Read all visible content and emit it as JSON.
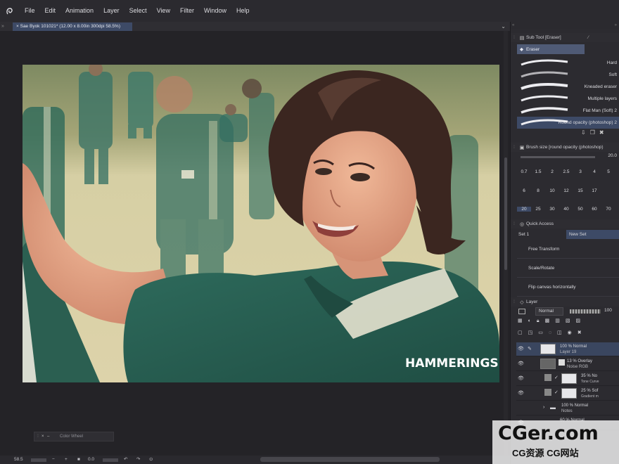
{
  "menu": {
    "items": [
      "File",
      "Edit",
      "Animation",
      "Layer",
      "Select",
      "View",
      "Filter",
      "Window",
      "Help"
    ]
  },
  "document_tab": {
    "title": "Sae Byok 101021* (12.00 x 8.00in 300dpi 58.5%)"
  },
  "artwork": {
    "signature": "HAMMERINGS"
  },
  "sub_tool": {
    "header": "Sub Tool [Eraser]",
    "group": "Eraser",
    "brushes": [
      {
        "label": "Hard",
        "selected": false
      },
      {
        "label": "Soft",
        "selected": false
      },
      {
        "label": "Kneaded eraser",
        "selected": false
      },
      {
        "label": "Multiple layers",
        "selected": false
      },
      {
        "label": "Flat Man (Soft) 2",
        "selected": false
      },
      {
        "label": "Round opacity (photoshop) 2",
        "selected": true
      }
    ]
  },
  "brush_size": {
    "header": "Brush size [round opacity (photoshop)",
    "value": "20.0",
    "row1": [
      "0.7",
      "1.5",
      "2",
      "2.5",
      "3",
      "4",
      "5"
    ],
    "row2": [
      "6",
      "8",
      "10",
      "12",
      "15",
      "17"
    ],
    "row3": [
      "20",
      "25",
      "30",
      "40",
      "50",
      "60",
      "70"
    ],
    "selected": "20"
  },
  "quick_access": {
    "header": "Quick Access",
    "set_label": "Set 1",
    "new_set": "New Set",
    "items": [
      "Free Transform",
      "Scale/Rotate",
      "Flip canvas horizontally"
    ]
  },
  "layer_panel": {
    "header": "Layer",
    "blend_mode": "Normal",
    "opacity": "100",
    "layers": [
      {
        "line1": "100 % Normal",
        "line2": "Layer 19",
        "selected": true
      },
      {
        "line1": "13 % Overlay",
        "line2": "Noise RGB",
        "selected": false
      },
      {
        "line1": "35 % No",
        "line2": "Tone Curve",
        "selected": false
      },
      {
        "line1": "25 % Sof",
        "line2": "Gradient m",
        "selected": false
      },
      {
        "line1": "100 % Normal",
        "line2": "Notes",
        "selected": false
      },
      {
        "line1": "60 % Normal",
        "line2": "",
        "selected": false
      }
    ]
  },
  "color_wheel": {
    "label": "Color Wheel"
  },
  "status": {
    "zoom": "58.5",
    "rotation": "0.0"
  },
  "watermark": {
    "brand": "CGer.com",
    "sub": "CG资源 CG网站"
  },
  "colors": {
    "selection": "#3d4a66",
    "panel": "#2c2b30",
    "canvas_bg": "#242327"
  }
}
